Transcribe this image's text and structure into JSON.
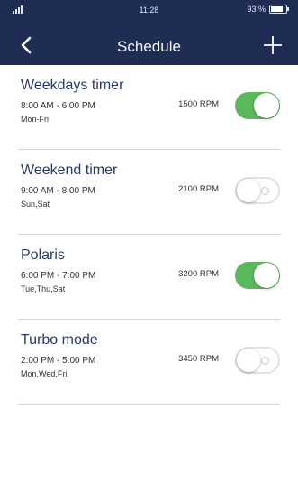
{
  "status_bar": {
    "time": "11:28",
    "battery_label": "93 %"
  },
  "header": {
    "title": "Schedule"
  },
  "schedules": [
    {
      "name": "Weekdays timer",
      "time_range": "8:00 AM - 6:00 PM",
      "days": "Mon-Fri",
      "rpm": "1500 RPM",
      "enabled": true
    },
    {
      "name": "Weekend timer",
      "time_range": "9:00 AM - 8:00 PM",
      "days": "Sun,Sat",
      "rpm": "2100 RPM",
      "enabled": false
    },
    {
      "name": "Polaris",
      "time_range": "6:00 PM - 7:00 PM",
      "days": "Tue,Thu,Sat",
      "rpm": "3200 RPM",
      "enabled": true
    },
    {
      "name": "Turbo mode",
      "time_range": "2:00 PM - 5:00 PM",
      "days": "Mon,Wed,Fri",
      "rpm": "3450 RPM",
      "enabled": false
    }
  ],
  "colors": {
    "header_bg": "#1f2d55",
    "toggle_on": "#5cb85c",
    "title_text": "#2a3a66"
  },
  "icons": {
    "back": "chevron-left-icon",
    "add": "plus-icon"
  }
}
